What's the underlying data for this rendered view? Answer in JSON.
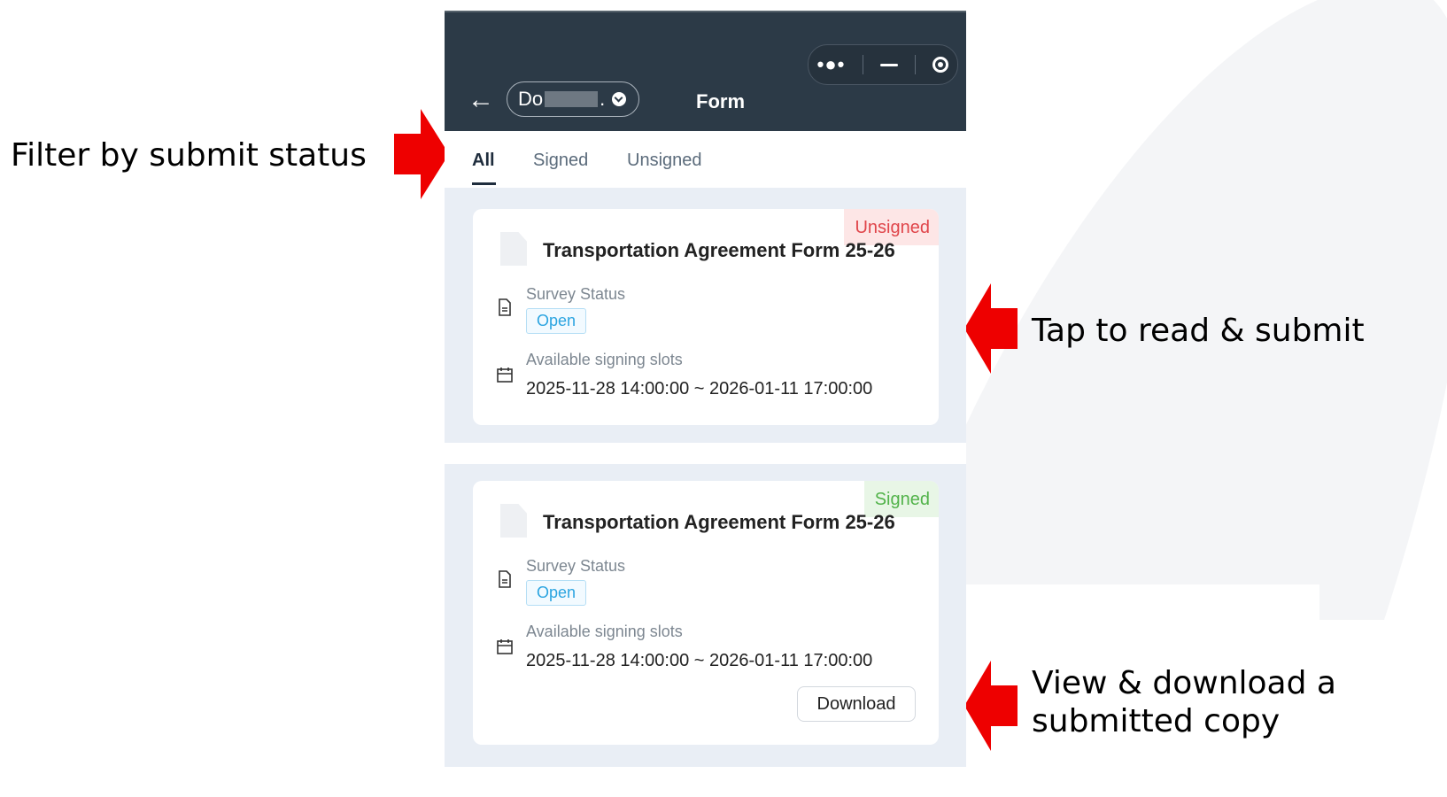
{
  "annotations": {
    "filter": "Filter by submit status",
    "tap": "Tap to read & submit",
    "view": "View & download a submitted copy"
  },
  "colors": {
    "arrow": "#ee0000",
    "topbar": "#2c3a47",
    "unsigned": "#e0454a",
    "signed": "#52b34a",
    "tag": "#2ba4e0"
  },
  "header": {
    "school_prefix": "Do",
    "school_suffix": ".",
    "title": "Form"
  },
  "tabs": [
    {
      "label": "All",
      "active": true
    },
    {
      "label": "Signed",
      "active": false
    },
    {
      "label": "Unsigned",
      "active": false
    }
  ],
  "cards": [
    {
      "badge": "Unsigned",
      "title": "Transportation Agreement Form 25-26",
      "status_label": "Survey Status",
      "status_value": "Open",
      "slots_label": "Available signing slots",
      "slots_value": "2025-11-28 14:00:00 ~ 2026-01-11 17:00:00"
    },
    {
      "badge": "Signed",
      "title": "Transportation Agreement Form 25-26",
      "status_label": "Survey Status",
      "status_value": "Open",
      "slots_label": "Available signing slots",
      "slots_value": "2025-11-28 14:00:00 ~ 2026-01-11 17:00:00",
      "download_label": "Download"
    }
  ],
  "icons": [
    "back-arrow-icon",
    "more-dots-icon",
    "minimize-icon",
    "close-target-icon",
    "chevron-down-icon",
    "document-icon",
    "file-text-icon",
    "calendar-icon",
    "red-arrow-icon"
  ]
}
